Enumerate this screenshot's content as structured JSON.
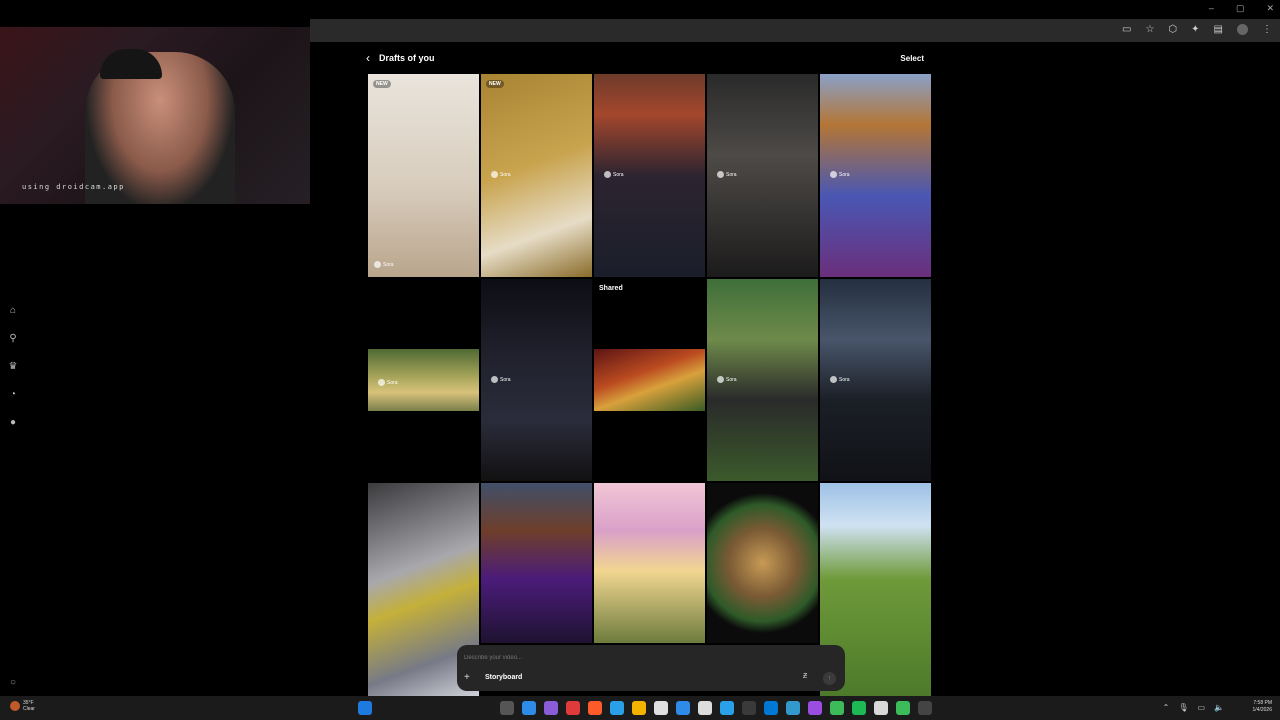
{
  "browser": {
    "window_controls": [
      "–",
      "▢",
      "✕"
    ],
    "toolbar_icons": [
      "cast-icon",
      "star-icon",
      "extensions-icon",
      "puzzle-icon",
      "sidebar-icon",
      "profile-icon",
      "menu-icon"
    ]
  },
  "webcam": {
    "overlay_text": "using droidcam.app"
  },
  "sidebar": {
    "items": [
      {
        "icon": "home-icon",
        "glyph": "⌂"
      },
      {
        "icon": "search-icon",
        "glyph": "⚲"
      },
      {
        "icon": "trophy-icon",
        "glyph": "♛"
      },
      {
        "icon": "bell-icon",
        "glyph": "◔"
      },
      {
        "icon": "profile-icon",
        "glyph": "●"
      }
    ],
    "settings_glyph": "○"
  },
  "header": {
    "back_glyph": "‹",
    "title": "Drafts of you",
    "select_label": "Select"
  },
  "grid": {
    "shared_label": "Shared",
    "rows": [
      [
        {
          "badge": "NEW",
          "watermark": "Sora",
          "bg": "linear-gradient(180deg,#e9e4dc 0%,#d8cdbd 55%,#b9a58c 100%)"
        },
        {
          "badge": "NEW",
          "watermark": "Sora",
          "bg": "linear-gradient(160deg,#a88433 0%,#c9a44f 45%,#e6dcc6 75%,#8a6c2a 100%)"
        },
        {
          "badge": "",
          "watermark": "Sora",
          "bg": "linear-gradient(180deg,#6e3b2a 0%,#a4472d 20%,#2c2430 50%,#1a1e2a 100%)"
        },
        {
          "badge": "",
          "watermark": "Sora",
          "bg": "linear-gradient(180deg,#2a2a2a 0%,#4d4a47 40%,#1c1b1b 100%)"
        },
        {
          "badge": "",
          "watermark": "Sora",
          "bg": "linear-gradient(180deg,#8aa0c8 0%,#b47636 25%,#4957b3 60%,#6b2f7c 100%)"
        }
      ],
      [
        {
          "badge": "",
          "watermark": "Sora",
          "bg": "linear-gradient(180deg,#4f6a33 0%,#a7a55a 45%,#d8c27a 70%,#7a7f4a 100%)"
        },
        {
          "badge": "",
          "watermark": "Sora",
          "bg": "linear-gradient(180deg,#0d0d14 0%,#21222e 40%,#2b2c3b 70%,#111 100%)"
        },
        {
          "badge": "",
          "watermark": "",
          "bg": "linear-gradient(160deg,#5c1414 0%,#bb4b20 40%,#d8a13c 60%,#3a5b24 100%)"
        },
        {
          "badge": "",
          "watermark": "Sora",
          "bg": "linear-gradient(180deg,#3f6f3a 0%,#6e8a4a 30%,#2a2a2a 60%,#3b5a2b 100%)"
        },
        {
          "badge": "",
          "watermark": "Sora",
          "bg": "linear-gradient(180deg,#243040 0%,#48556a 30%,#1b1f26 60%,#101216 100%)"
        }
      ],
      [
        {
          "badge": "",
          "watermark": "",
          "bg": "linear-gradient(160deg,#3b3b3e 0%,#a8a8ad 40%,#c4b03a 55%,#777a86 80%,#cfd2d9 100%)"
        },
        {
          "badge": "",
          "watermark": "",
          "bg": "linear-gradient(180deg,#41506a 0%,#6e3e2a 30%,#4b1c7a 60%,#1e1230 100%)"
        },
        {
          "badge": "",
          "watermark": "",
          "bg": "linear-gradient(180deg,#f2c6d6 0%,#d9a0c8 30%,#f1d690 55%,#6d7b3d 100%)"
        },
        {
          "badge": "",
          "watermark": "",
          "bg": "radial-gradient(circle at 50% 50%,#c79a55 0%,#7a5a35 35%,#2e5a28 60%,#0b0b0b 72%)"
        },
        {
          "badge": "",
          "watermark": "",
          "bg": "linear-gradient(180deg,#9ec1e6 0%,#cfe2f2 20%,#6f9a3a 45%,#4d7a2a 100%)"
        }
      ]
    ]
  },
  "prompt": {
    "placeholder": "Describe your video...",
    "plus_glyph": "+",
    "storyboard_label": "Storyboard",
    "count_glyph": "Ƶ",
    "send_glyph": "↑"
  },
  "taskbar": {
    "weather_temp": "35°F",
    "weather_desc": "Clear",
    "apps": [
      "#1f7ae0",
      "#555",
      "#2f8be8",
      "#8a5cd8",
      "#e03a3a",
      "#ff5a2a",
      "#2aa0e8",
      "#f2b400",
      "#e0e0e0",
      "#2f8be8",
      "#ddd",
      "#2aa0e8",
      "#3a3a3a",
      "#0078d4",
      "#39c",
      "#9b4de0",
      "#3dbb5a",
      "#1db954",
      "#d8d8d8",
      "#3dbb5a",
      "#444"
    ],
    "tray": [
      "⌃",
      "🎙",
      "▭",
      "🔈"
    ],
    "time": "7:58 PM",
    "date": "1/4/2026"
  }
}
